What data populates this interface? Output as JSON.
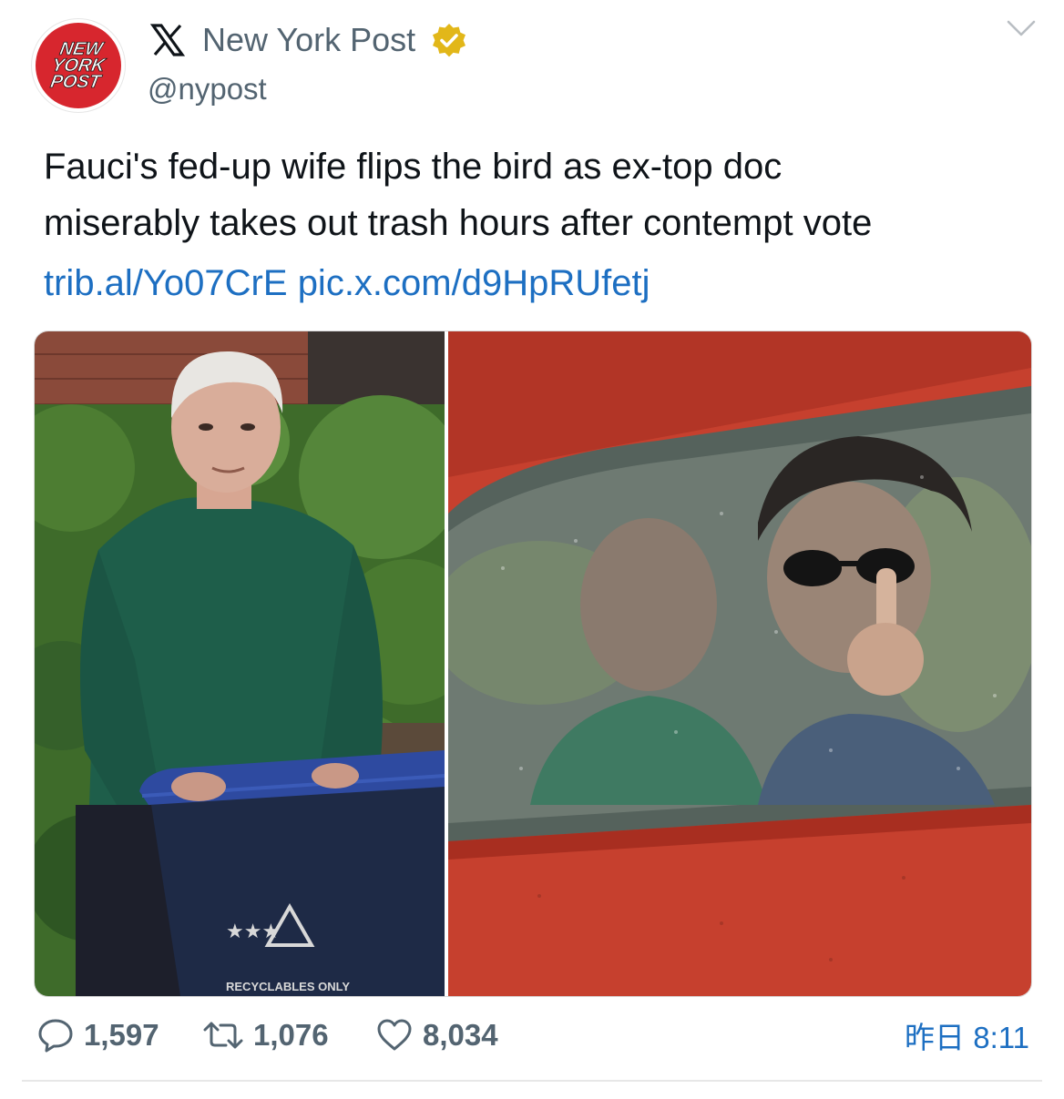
{
  "author": {
    "avatar_text": [
      "NEW",
      "YORK",
      "POST"
    ],
    "name": "New York Post",
    "handle": "@nypost",
    "platform_icon": "x-logo-icon",
    "verified_icon": "gold-verified-badge-icon"
  },
  "tweet": {
    "text_lines": [
      "Fauci's fed-up wife flips the bird as ex-top doc",
      "miserably takes out trash hours after contempt vote"
    ],
    "link_1": "trib.al/Yo07CrE",
    "link_2": "pic.x.com/d9HpRUfetj"
  },
  "media": {
    "left_photo_visible_text": "RECYCLABLES ONLY"
  },
  "stats": {
    "replies": "1,597",
    "reposts": "1,076",
    "likes": "8,034",
    "timestamp": "昨日 8:11"
  },
  "colors": {
    "link_blue": "#1d6fc2",
    "secondary_gray": "#536471",
    "brand_red": "#d7262e",
    "verified_gold": "#e2b719"
  }
}
